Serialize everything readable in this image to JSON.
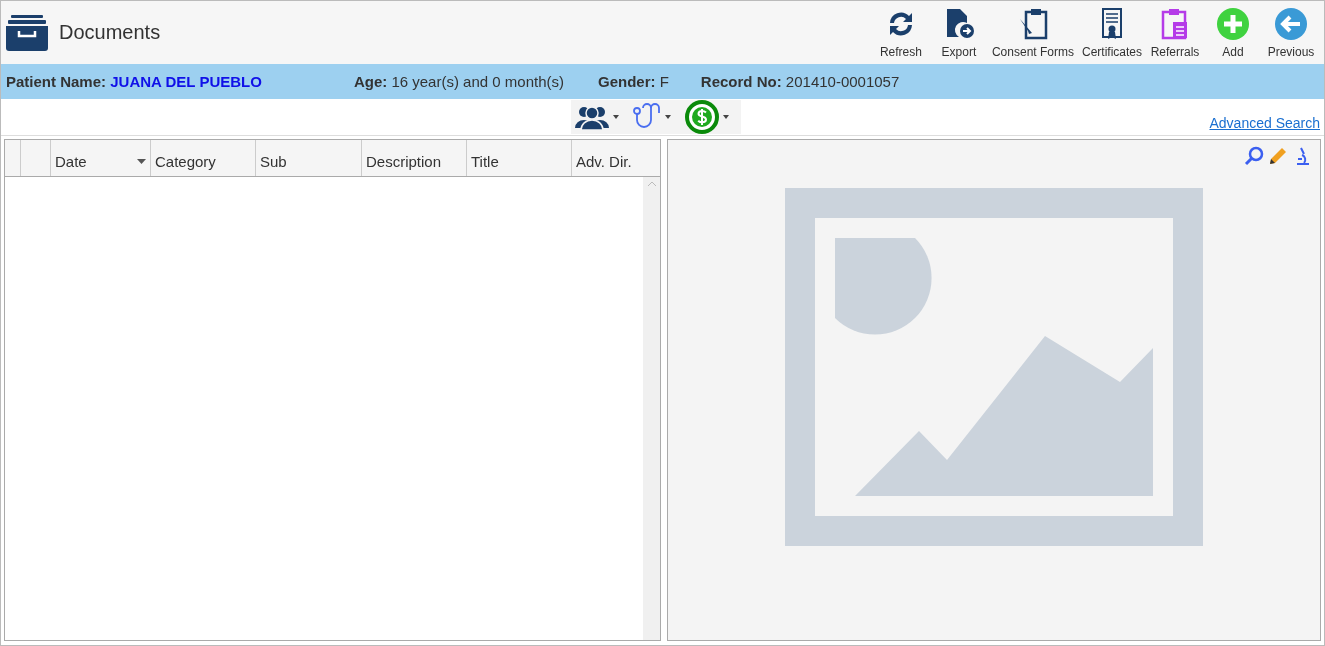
{
  "window": {
    "title": "Documents"
  },
  "toolbar": [
    {
      "label": "Refresh",
      "kind": "refresh"
    },
    {
      "label": "Export",
      "kind": "export"
    },
    {
      "label": "Consent Forms",
      "kind": "consent"
    },
    {
      "label": "Certificates",
      "kind": "certificate"
    },
    {
      "label": "Referrals",
      "kind": "referral"
    },
    {
      "label": "Add",
      "kind": "add"
    },
    {
      "label": "Previous",
      "kind": "previous"
    }
  ],
  "patient": [
    {
      "label": "Patient Name:",
      "value": "JUANA DEL PUEBLO",
      "kind": "name"
    },
    {
      "label": "Age:",
      "value": "16 year(s) and 0 month(s)",
      "kind": "plain"
    },
    {
      "label": "Gender:",
      "value": "F",
      "kind": "plain"
    },
    {
      "label": "Record No:",
      "value": "201410-0001057",
      "kind": "plain"
    }
  ],
  "filters": [
    {
      "kind": "people"
    },
    {
      "kind": "stethoscope"
    },
    {
      "kind": "billing"
    }
  ],
  "advanced_search": "Advanced Search",
  "table": {
    "columns": [
      {
        "sorted": false
      },
      {
        "label": "Date",
        "sorted": true
      },
      {
        "label": "Category",
        "sorted": false
      },
      {
        "label": "Sub",
        "sorted": false
      },
      {
        "label": "Description",
        "sorted": false
      },
      {
        "label": "Title",
        "sorted": false
      },
      {
        "label": "Adv. Dir.",
        "sorted": false
      }
    ]
  },
  "preview": {
    "tools": [
      {
        "kind": "search"
      },
      {
        "kind": "edit"
      },
      {
        "kind": "microscope"
      }
    ]
  }
}
